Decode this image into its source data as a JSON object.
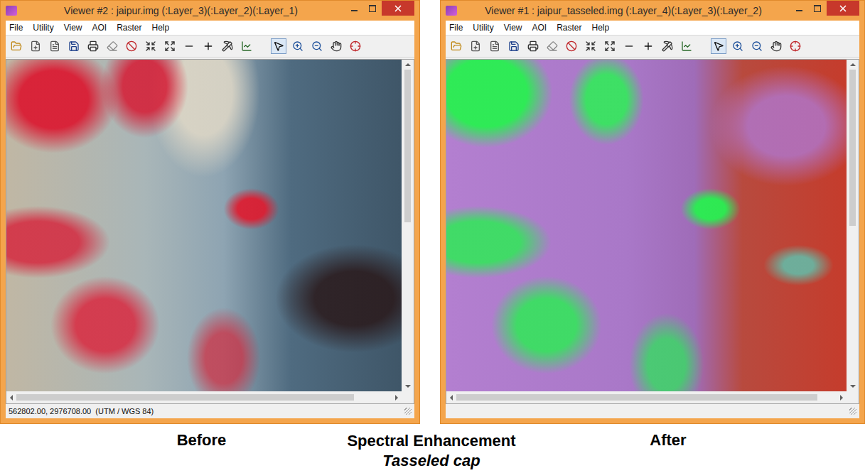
{
  "windows": [
    {
      "title": "Viewer #2 : jaipur.img (:Layer_3)(:Layer_2)(:Layer_1)",
      "image_kind": "false-color",
      "menus": [
        "File",
        "Utility",
        "View",
        "AOI",
        "Raster",
        "Help"
      ],
      "tools": [
        {
          "selected": false
        },
        {
          "selected": false
        },
        {
          "selected": false
        },
        {
          "selected": false
        },
        {
          "selected": false
        },
        {
          "selected": false
        },
        {
          "selected": false
        },
        {
          "selected": false
        },
        {
          "selected": false
        },
        {
          "selected": false
        },
        {
          "selected": false
        },
        {
          "selected": false
        },
        {
          "selected": false
        },
        {
          "selected": true
        },
        {
          "selected": false
        },
        {
          "selected": false
        },
        {
          "selected": false
        },
        {
          "selected": false
        }
      ],
      "scroll": {
        "vertical_level": 0.49,
        "horizontal_level": 0.9
      },
      "status": "562802.00, 2976708.00  (UTM / WGS 84)"
    },
    {
      "title": "Viewer #1 : jaipur_tasseled.img (:Layer_4)(:Layer_3)(:Layer_2)",
      "image_kind": "tasseled-cap",
      "menus": [
        "File",
        "Utility",
        "View",
        "AOI",
        "Raster",
        "Help"
      ],
      "tools": [
        {
          "selected": false
        },
        {
          "selected": false
        },
        {
          "selected": false
        },
        {
          "selected": false
        },
        {
          "selected": false
        },
        {
          "selected": false
        },
        {
          "selected": false
        },
        {
          "selected": false
        },
        {
          "selected": false
        },
        {
          "selected": false
        },
        {
          "selected": false
        },
        {
          "selected": false
        },
        {
          "selected": false
        },
        {
          "selected": true
        },
        {
          "selected": false
        },
        {
          "selected": false
        },
        {
          "selected": false
        },
        {
          "selected": false
        }
      ],
      "scroll": {
        "vertical_level": 0.5,
        "horizontal_level": 0.95
      },
      "status": ""
    }
  ],
  "captions": {
    "before": "Before",
    "title": "Spectral Enhancement",
    "subtitle": "Tasseled cap",
    "after": "After"
  }
}
